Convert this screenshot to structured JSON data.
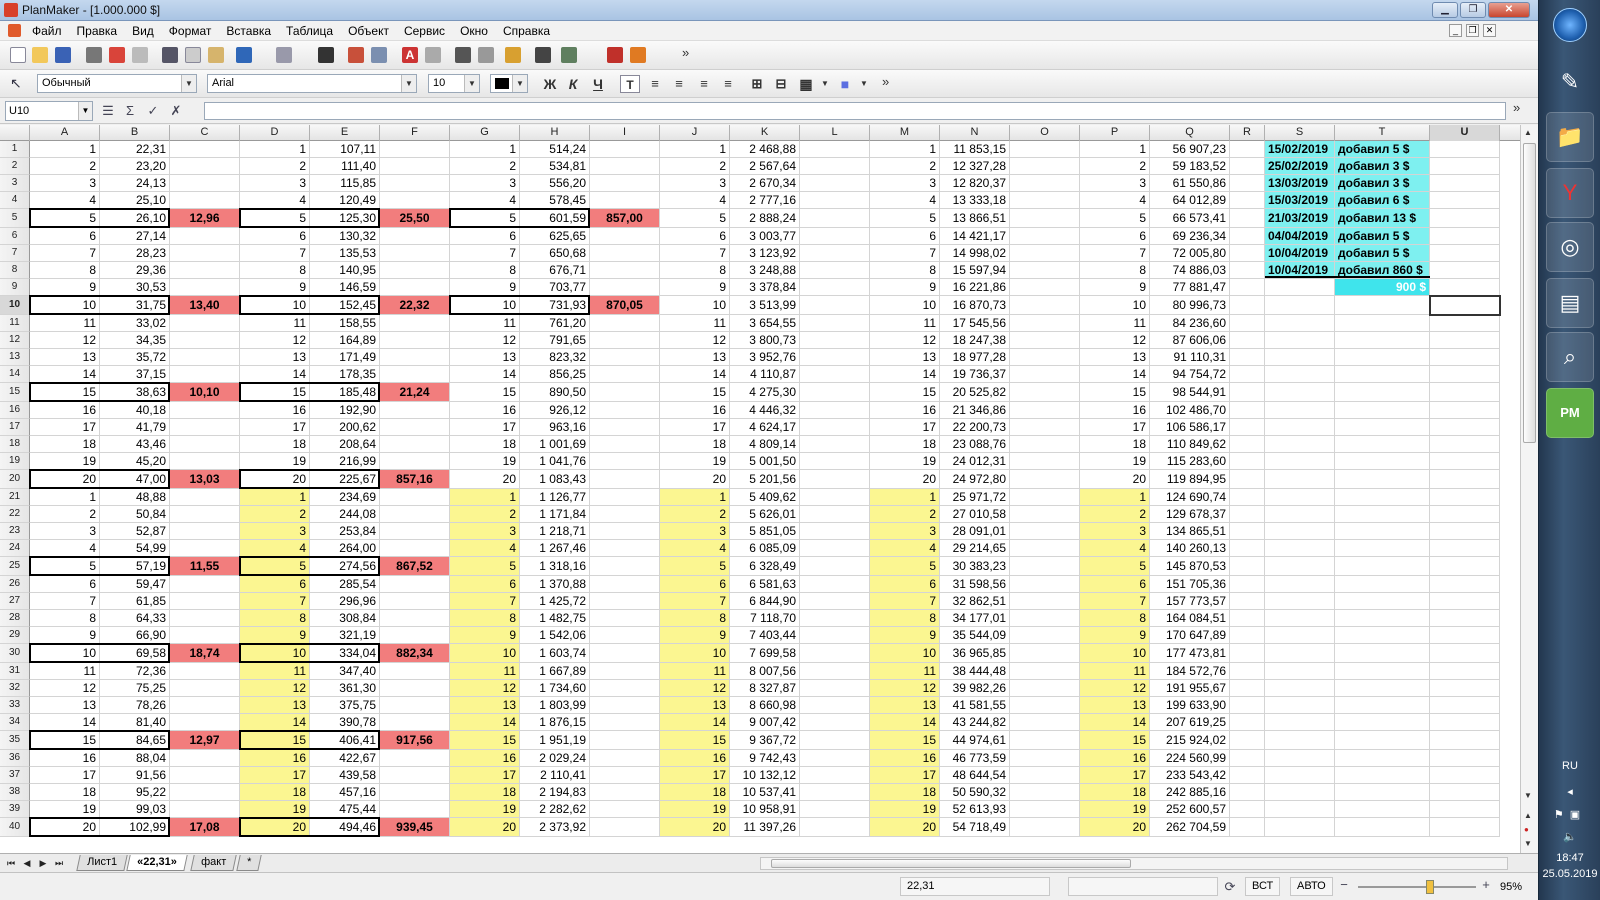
{
  "window": {
    "title": "PlanMaker - [1.000.000 $]"
  },
  "menu": [
    "Файл",
    "Правка",
    "Вид",
    "Формат",
    "Вставка",
    "Таблица",
    "Объект",
    "Сервис",
    "Окно",
    "Справка"
  ],
  "toolbar2": {
    "style": "Обычный",
    "font": "Arial",
    "size": "10"
  },
  "formula": {
    "cell_ref": "U10",
    "content": ""
  },
  "columns": [
    "A",
    "B",
    "C",
    "D",
    "E",
    "F",
    "G",
    "H",
    "I",
    "J",
    "K",
    "L",
    "M",
    "N",
    "O",
    "P",
    "Q",
    "R",
    "S",
    "T",
    "U"
  ],
  "selected_column": "U",
  "selected_row": "10",
  "rows": [
    {
      "n": "1",
      "A": "1",
      "B": "22,31",
      "D": "1",
      "E": "107,11",
      "G": "1",
      "H": "514,24",
      "J": "1",
      "K": "2 468,88",
      "M": "1",
      "N": "11 853,15",
      "P": "1",
      "Q": "56 907,23",
      "S": "15/02/2019",
      "T": "добавил 5 $"
    },
    {
      "n": "2",
      "A": "2",
      "B": "23,20",
      "D": "2",
      "E": "111,40",
      "G": "2",
      "H": "534,81",
      "J": "2",
      "K": "2 567,64",
      "M": "2",
      "N": "12 327,28",
      "P": "2",
      "Q": "59 183,52",
      "S": "25/02/2019",
      "T": "добавил 3 $"
    },
    {
      "n": "3",
      "A": "3",
      "B": "24,13",
      "D": "3",
      "E": "115,85",
      "G": "3",
      "H": "556,20",
      "J": "3",
      "K": "2 670,34",
      "M": "3",
      "N": "12 820,37",
      "P": "3",
      "Q": "61 550,86",
      "S": "13/03/2019",
      "T": "добавил 3 $"
    },
    {
      "n": "4",
      "A": "4",
      "B": "25,10",
      "D": "4",
      "E": "120,49",
      "G": "4",
      "H": "578,45",
      "J": "4",
      "K": "2 777,16",
      "M": "4",
      "N": "13 333,18",
      "P": "4",
      "Q": "64 012,89",
      "S": "15/03/2019",
      "T": "добавил 6 $"
    },
    {
      "n": "5",
      "A": "5",
      "B": "26,10",
      "C": "12,96",
      "D": "5",
      "E": "125,30",
      "F": "25,50",
      "G": "5",
      "H": "601,59",
      "I": "857,00",
      "J": "5",
      "K": "2 888,24",
      "M": "5",
      "N": "13 866,51",
      "P": "5",
      "Q": "66 573,41",
      "S": "21/03/2019",
      "T": "добавил 13 $"
    },
    {
      "n": "6",
      "A": "6",
      "B": "27,14",
      "D": "6",
      "E": "130,32",
      "G": "6",
      "H": "625,65",
      "J": "6",
      "K": "3 003,77",
      "M": "6",
      "N": "14 421,17",
      "P": "6",
      "Q": "69 236,34",
      "S": "04/04/2019",
      "T": "добавил 5 $"
    },
    {
      "n": "7",
      "A": "7",
      "B": "28,23",
      "D": "7",
      "E": "135,53",
      "G": "7",
      "H": "650,68",
      "J": "7",
      "K": "3 123,92",
      "M": "7",
      "N": "14 998,02",
      "P": "7",
      "Q": "72 005,80",
      "S": "10/04/2019",
      "T": "добавил 5 $"
    },
    {
      "n": "8",
      "A": "8",
      "B": "29,36",
      "D": "8",
      "E": "140,95",
      "G": "8",
      "H": "676,71",
      "J": "8",
      "K": "3 248,88",
      "M": "8",
      "N": "15 597,94",
      "P": "8",
      "Q": "74 886,03",
      "S": "10/04/2019",
      "T": "добавил 860 $"
    },
    {
      "n": "9",
      "A": "9",
      "B": "30,53",
      "D": "9",
      "E": "146,59",
      "G": "9",
      "H": "703,77",
      "J": "9",
      "K": "3 378,84",
      "M": "9",
      "N": "16 221,86",
      "P": "9",
      "Q": "77 881,47",
      "T": "900 $"
    },
    {
      "n": "10",
      "A": "10",
      "B": "31,75",
      "C": "13,40",
      "D": "10",
      "E": "152,45",
      "F": "22,32",
      "G": "10",
      "H": "731,93",
      "I": "870,05",
      "J": "10",
      "K": "3 513,99",
      "M": "10",
      "N": "16 870,73",
      "P": "10",
      "Q": "80 996,73"
    },
    {
      "n": "11",
      "A": "11",
      "B": "33,02",
      "D": "11",
      "E": "158,55",
      "G": "11",
      "H": "761,20",
      "J": "11",
      "K": "3 654,55",
      "M": "11",
      "N": "17 545,56",
      "P": "11",
      "Q": "84 236,60"
    },
    {
      "n": "12",
      "A": "12",
      "B": "34,35",
      "D": "12",
      "E": "164,89",
      "G": "12",
      "H": "791,65",
      "J": "12",
      "K": "3 800,73",
      "M": "12",
      "N": "18 247,38",
      "P": "12",
      "Q": "87 606,06"
    },
    {
      "n": "13",
      "A": "13",
      "B": "35,72",
      "D": "13",
      "E": "171,49",
      "G": "13",
      "H": "823,32",
      "J": "13",
      "K": "3 952,76",
      "M": "13",
      "N": "18 977,28",
      "P": "13",
      "Q": "91 110,31"
    },
    {
      "n": "14",
      "A": "14",
      "B": "37,15",
      "D": "14",
      "E": "178,35",
      "G": "14",
      "H": "856,25",
      "J": "14",
      "K": "4 110,87",
      "M": "14",
      "N": "19 736,37",
      "P": "14",
      "Q": "94 754,72"
    },
    {
      "n": "15",
      "A": "15",
      "B": "38,63",
      "C": "10,10",
      "D": "15",
      "E": "185,48",
      "F": "21,24",
      "G": "15",
      "H": "890,50",
      "J": "15",
      "K": "4 275,30",
      "M": "15",
      "N": "20 525,82",
      "P": "15",
      "Q": "98 544,91"
    },
    {
      "n": "16",
      "A": "16",
      "B": "40,18",
      "D": "16",
      "E": "192,90",
      "G": "16",
      "H": "926,12",
      "J": "16",
      "K": "4 446,32",
      "M": "16",
      "N": "21 346,86",
      "P": "16",
      "Q": "102 486,70"
    },
    {
      "n": "17",
      "A": "17",
      "B": "41,79",
      "D": "17",
      "E": "200,62",
      "G": "17",
      "H": "963,16",
      "J": "17",
      "K": "4 624,17",
      "M": "17",
      "N": "22 200,73",
      "P": "17",
      "Q": "106 586,17"
    },
    {
      "n": "18",
      "A": "18",
      "B": "43,46",
      "D": "18",
      "E": "208,64",
      "G": "18",
      "H": "1 001,69",
      "J": "18",
      "K": "4 809,14",
      "M": "18",
      "N": "23 088,76",
      "P": "18",
      "Q": "110 849,62"
    },
    {
      "n": "19",
      "A": "19",
      "B": "45,20",
      "D": "19",
      "E": "216,99",
      "G": "19",
      "H": "1 041,76",
      "J": "19",
      "K": "5 001,50",
      "M": "19",
      "N": "24 012,31",
      "P": "19",
      "Q": "115 283,60"
    },
    {
      "n": "20",
      "A": "20",
      "B": "47,00",
      "C": "13,03",
      "D": "20",
      "E": "225,67",
      "F": "857,16",
      "G": "20",
      "H": "1 083,43",
      "J": "20",
      "K": "5 201,56",
      "M": "20",
      "N": "24 972,80",
      "P": "20",
      "Q": "119 894,95"
    },
    {
      "n": "21",
      "A": "1",
      "B": "48,88",
      "D": "1",
      "E": "234,69",
      "G": "1",
      "H": "1 126,77",
      "J": "1",
      "K": "5 409,62",
      "M": "1",
      "N": "25 971,72",
      "P": "1",
      "Q": "124 690,74"
    },
    {
      "n": "22",
      "A": "2",
      "B": "50,84",
      "D": "2",
      "E": "244,08",
      "G": "2",
      "H": "1 171,84",
      "J": "2",
      "K": "5 626,01",
      "M": "2",
      "N": "27 010,58",
      "P": "2",
      "Q": "129 678,37"
    },
    {
      "n": "23",
      "A": "3",
      "B": "52,87",
      "D": "3",
      "E": "253,84",
      "G": "3",
      "H": "1 218,71",
      "J": "3",
      "K": "5 851,05",
      "M": "3",
      "N": "28 091,01",
      "P": "3",
      "Q": "134 865,51"
    },
    {
      "n": "24",
      "A": "4",
      "B": "54,99",
      "D": "4",
      "E": "264,00",
      "G": "4",
      "H": "1 267,46",
      "J": "4",
      "K": "6 085,09",
      "M": "4",
      "N": "29 214,65",
      "P": "4",
      "Q": "140 260,13"
    },
    {
      "n": "25",
      "A": "5",
      "B": "57,19",
      "C": "11,55",
      "D": "5",
      "E": "274,56",
      "F": "867,52",
      "G": "5",
      "H": "1 318,16",
      "J": "5",
      "K": "6 328,49",
      "M": "5",
      "N": "30 383,23",
      "P": "5",
      "Q": "145 870,53"
    },
    {
      "n": "26",
      "A": "6",
      "B": "59,47",
      "D": "6",
      "E": "285,54",
      "G": "6",
      "H": "1 370,88",
      "J": "6",
      "K": "6 581,63",
      "M": "6",
      "N": "31 598,56",
      "P": "6",
      "Q": "151 705,36"
    },
    {
      "n": "27",
      "A": "7",
      "B": "61,85",
      "D": "7",
      "E": "296,96",
      "G": "7",
      "H": "1 425,72",
      "J": "7",
      "K": "6 844,90",
      "M": "7",
      "N": "32 862,51",
      "P": "7",
      "Q": "157 773,57"
    },
    {
      "n": "28",
      "A": "8",
      "B": "64,33",
      "D": "8",
      "E": "308,84",
      "G": "8",
      "H": "1 482,75",
      "J": "8",
      "K": "7 118,70",
      "M": "8",
      "N": "34 177,01",
      "P": "8",
      "Q": "164 084,51"
    },
    {
      "n": "29",
      "A": "9",
      "B": "66,90",
      "D": "9",
      "E": "321,19",
      "G": "9",
      "H": "1 542,06",
      "J": "9",
      "K": "7 403,44",
      "M": "9",
      "N": "35 544,09",
      "P": "9",
      "Q": "170 647,89"
    },
    {
      "n": "30",
      "A": "10",
      "B": "69,58",
      "C": "18,74",
      "D": "10",
      "E": "334,04",
      "F": "882,34",
      "G": "10",
      "H": "1 603,74",
      "J": "10",
      "K": "7 699,58",
      "M": "10",
      "N": "36 965,85",
      "P": "10",
      "Q": "177 473,81"
    },
    {
      "n": "31",
      "A": "11",
      "B": "72,36",
      "D": "11",
      "E": "347,40",
      "G": "11",
      "H": "1 667,89",
      "J": "11",
      "K": "8 007,56",
      "M": "11",
      "N": "38 444,48",
      "P": "11",
      "Q": "184 572,76"
    },
    {
      "n": "32",
      "A": "12",
      "B": "75,25",
      "D": "12",
      "E": "361,30",
      "G": "12",
      "H": "1 734,60",
      "J": "12",
      "K": "8 327,87",
      "M": "12",
      "N": "39 982,26",
      "P": "12",
      "Q": "191 955,67"
    },
    {
      "n": "33",
      "A": "13",
      "B": "78,26",
      "D": "13",
      "E": "375,75",
      "G": "13",
      "H": "1 803,99",
      "J": "13",
      "K": "8 660,98",
      "M": "13",
      "N": "41 581,55",
      "P": "13",
      "Q": "199 633,90"
    },
    {
      "n": "34",
      "A": "14",
      "B": "81,40",
      "D": "14",
      "E": "390,78",
      "G": "14",
      "H": "1 876,15",
      "J": "14",
      "K": "9 007,42",
      "M": "14",
      "N": "43 244,82",
      "P": "14",
      "Q": "207 619,25"
    },
    {
      "n": "35",
      "A": "15",
      "B": "84,65",
      "C": "12,97",
      "D": "15",
      "E": "406,41",
      "F": "917,56",
      "G": "15",
      "H": "1 951,19",
      "J": "15",
      "K": "9 367,72",
      "M": "15",
      "N": "44 974,61",
      "P": "15",
      "Q": "215 924,02"
    },
    {
      "n": "36",
      "A": "16",
      "B": "88,04",
      "D": "16",
      "E": "422,67",
      "G": "16",
      "H": "2 029,24",
      "J": "16",
      "K": "9 742,43",
      "M": "16",
      "N": "46 773,59",
      "P": "16",
      "Q": "224 560,99"
    },
    {
      "n": "37",
      "A": "17",
      "B": "91,56",
      "D": "17",
      "E": "439,58",
      "G": "17",
      "H": "2 110,41",
      "J": "17",
      "K": "10 132,12",
      "M": "17",
      "N": "48 644,54",
      "P": "17",
      "Q": "233 543,42"
    },
    {
      "n": "38",
      "A": "18",
      "B": "95,22",
      "D": "18",
      "E": "457,16",
      "G": "18",
      "H": "2 194,83",
      "J": "18",
      "K": "10 537,41",
      "M": "18",
      "N": "50 590,32",
      "P": "18",
      "Q": "242 885,16"
    },
    {
      "n": "39",
      "A": "19",
      "B": "99,03",
      "D": "19",
      "E": "475,44",
      "G": "19",
      "H": "2 282,62",
      "J": "19",
      "K": "10 958,91",
      "M": "19",
      "N": "52 613,93",
      "P": "19",
      "Q": "252 600,57"
    },
    {
      "n": "40",
      "A": "20",
      "B": "102,99",
      "C": "17,08",
      "D": "20",
      "E": "494,46",
      "F": "939,45",
      "G": "20",
      "H": "2 373,92",
      "J": "20",
      "K": "11 397,26",
      "M": "20",
      "N": "54 718,49",
      "P": "20",
      "Q": "262 704,59"
    }
  ],
  "sheet_tabs": [
    "Лист1",
    "«22,31»",
    "факт",
    "*"
  ],
  "active_tab": "«22,31»",
  "status": {
    "value": "22,31",
    "mode_insert": "ВСТ",
    "mode_calc": "АВТО",
    "zoom": "95%"
  },
  "tray": {
    "lang": "RU",
    "time": "18:47",
    "date": "25.05.2019"
  },
  "colors": {
    "red": "#f27d7d",
    "yellow": "#fbf691",
    "cyan": "#7ef0f0",
    "cyan_total": "#3fe4ec"
  }
}
